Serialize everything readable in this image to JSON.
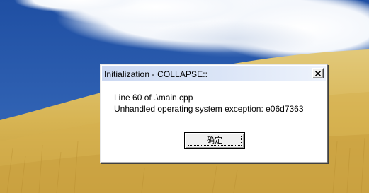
{
  "dialog": {
    "title": "Initialization - COLLAPSE::",
    "message_lines": [
      "Line 60 of .\\main.cpp",
      "Unhandled operating system exception: e06d7363"
    ],
    "ok_label": "确定",
    "close_icon": "close-x-icon"
  },
  "colors": {
    "sky": "#2d5aa8",
    "cloud": "#ffffff",
    "wheat": "#d9b65a",
    "title_bar": "#d4def4"
  }
}
